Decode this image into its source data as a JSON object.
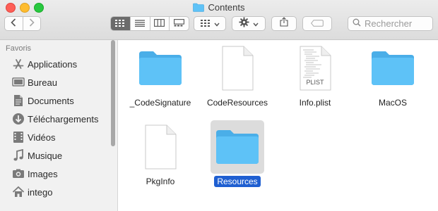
{
  "window": {
    "title": "Contents"
  },
  "toolbar": {
    "back": "back",
    "forward": "forward",
    "views": [
      "icon-view",
      "list-view",
      "column-view",
      "gallery-view"
    ],
    "active_view": "icon-view",
    "search_placeholder": "Rechercher"
  },
  "sidebar": {
    "heading": "Favoris",
    "items": [
      {
        "label": "Applications",
        "icon": "applications-icon"
      },
      {
        "label": "Bureau",
        "icon": "desktop-icon"
      },
      {
        "label": "Documents",
        "icon": "documents-icon"
      },
      {
        "label": "Téléchargements",
        "icon": "downloads-icon"
      },
      {
        "label": "Vidéos",
        "icon": "movies-icon"
      },
      {
        "label": "Musique",
        "icon": "music-icon"
      },
      {
        "label": "Images",
        "icon": "pictures-icon"
      },
      {
        "label": "intego",
        "icon": "home-icon"
      }
    ]
  },
  "files": [
    {
      "name": "_CodeSignature",
      "kind": "folder",
      "selected": false
    },
    {
      "name": "CodeResources",
      "kind": "document",
      "selected": false
    },
    {
      "name": "Info.plist",
      "kind": "plist",
      "badge": "PLIST",
      "selected": false
    },
    {
      "name": "MacOS",
      "kind": "folder",
      "selected": false
    },
    {
      "name": "PkgInfo",
      "kind": "document",
      "selected": false
    },
    {
      "name": "Resources",
      "kind": "folder",
      "selected": true
    }
  ],
  "colors": {
    "folder": "#5ec2f7",
    "selection": "#1f5fd1",
    "sidebar_bg": "#f1f1f1"
  }
}
